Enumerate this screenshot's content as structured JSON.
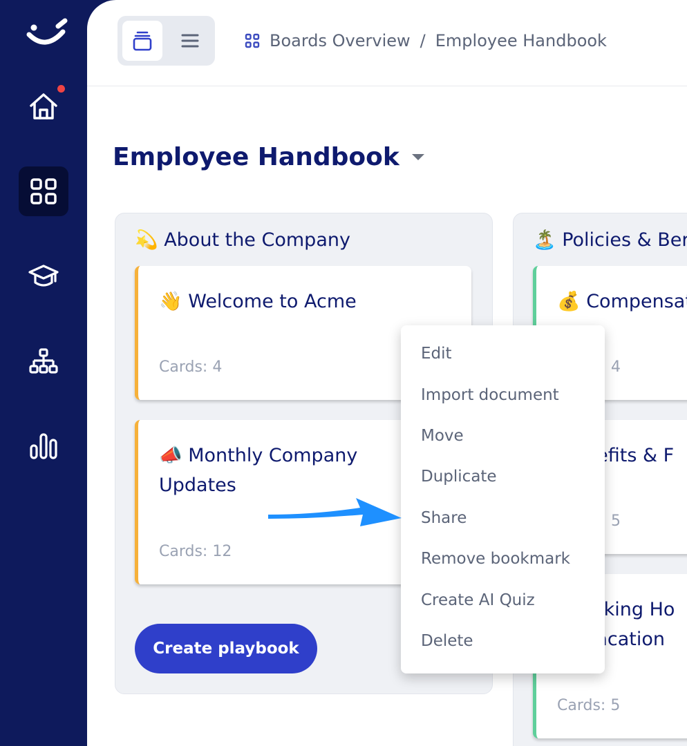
{
  "sidebar": {
    "items": [
      {
        "name": "home-icon",
        "active": false,
        "has_notification": true
      },
      {
        "name": "boards-grid-icon",
        "active": true
      },
      {
        "name": "graduation-cap-icon",
        "active": false
      },
      {
        "name": "org-chart-icon",
        "active": false
      },
      {
        "name": "bar-chart-icon",
        "active": false
      }
    ]
  },
  "header": {
    "view_toggle": [
      {
        "name": "board-view-icon",
        "active": true
      },
      {
        "name": "list-view-icon",
        "active": false
      }
    ],
    "breadcrumb": [
      "Boards Overview",
      "Employee Handbook"
    ],
    "separator": "/"
  },
  "page": {
    "title": "Employee Handbook"
  },
  "columns": [
    {
      "title": "💫 About the Company",
      "cards": [
        {
          "title": "👋 Welcome to Acme",
          "count": "Cards: 4"
        },
        {
          "title": "📣 Monthly Company Updates",
          "count": "Cards: 12"
        }
      ],
      "create_label": "Create playbook"
    },
    {
      "title": "🏝️ Policies & Ber",
      "cards": [
        {
          "title": "💰 Compensati",
          "count": "4"
        },
        {
          "title": "nefits & F",
          "count": "5"
        },
        {
          "title": "orking Ho\nVacation",
          "count": "Cards: 5"
        }
      ]
    }
  ],
  "context_menu": {
    "items": [
      "Edit",
      "Import document",
      "Move",
      "Duplicate",
      "Share",
      "Remove bookmark",
      "Create AI Quiz",
      "Delete"
    ]
  },
  "colors": {
    "sidebar": "#0e1a5c",
    "accent": "#2f3fca",
    "title": "#0e1a6e",
    "card_border_orange": "#f6b13a",
    "card_border_green": "#5fcf9b",
    "annotation_arrow": "#1e90ff"
  }
}
